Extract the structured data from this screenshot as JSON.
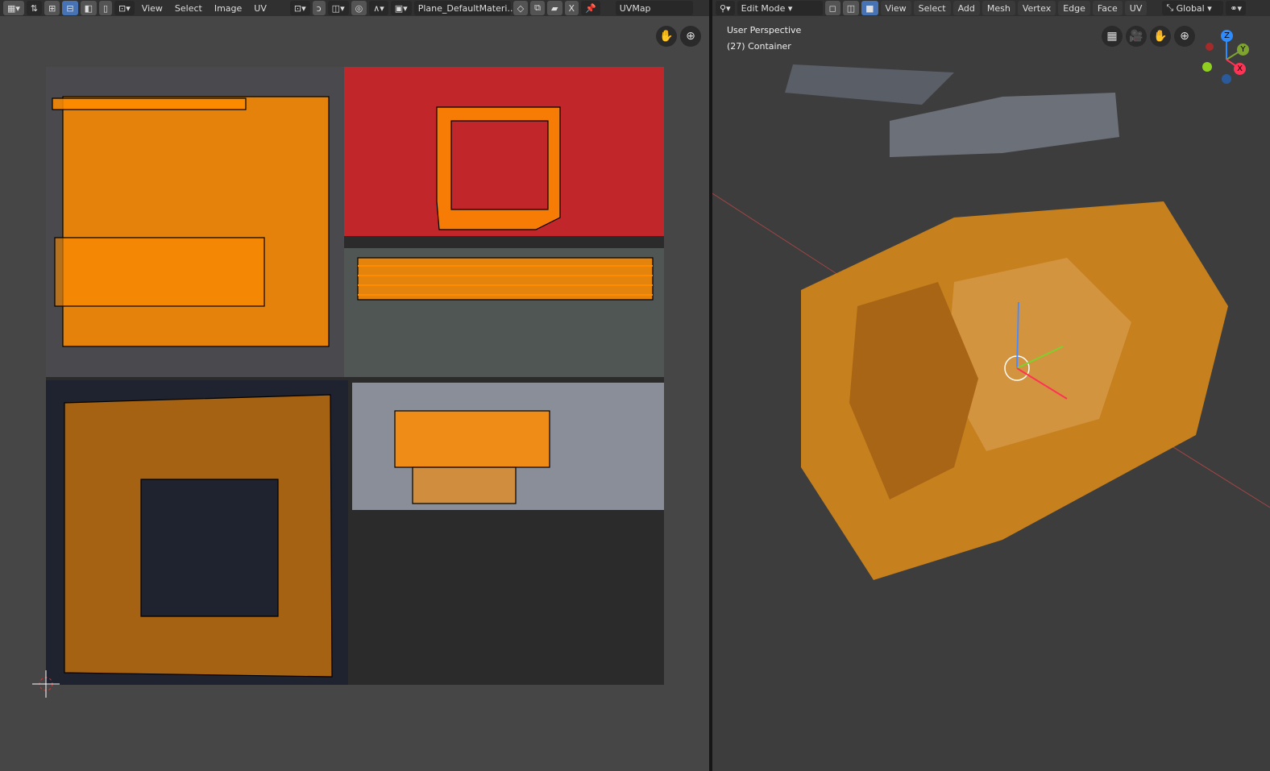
{
  "uv_header": {
    "menus": [
      "View",
      "Select",
      "Image",
      "UV"
    ],
    "image_name": "Plane_DefaultMateri...",
    "uv_map": "UVMap",
    "close": "X"
  },
  "vp_header": {
    "mode": "Edit Mode",
    "menus": [
      "View",
      "Select",
      "Add",
      "Mesh",
      "Vertex",
      "Edge",
      "Face",
      "UV"
    ],
    "orientation": "Global"
  },
  "viewport": {
    "view_name": "User Perspective",
    "object": "(27) Container",
    "gizmo": {
      "z": "Z",
      "y": "Y",
      "x": "X"
    }
  },
  "colors": {
    "accent": "#4772b3",
    "uv_orange": "#ff8c00",
    "red_texture": "#c0262a"
  }
}
